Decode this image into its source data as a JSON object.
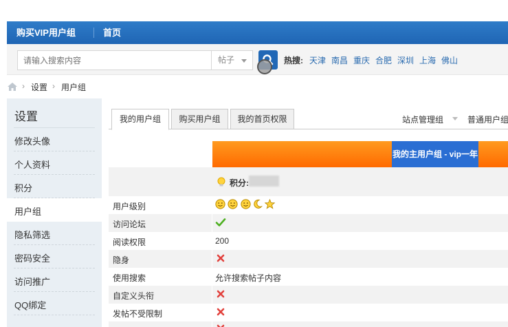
{
  "topbar": {
    "nav": [
      {
        "label": "购买VIP用户组"
      },
      {
        "label": "首页"
      }
    ]
  },
  "search": {
    "placeholder": "请输入搜索内容",
    "type_value": "帖子",
    "hot_label": "热搜:",
    "hot_links": [
      "天津",
      "南昌",
      "重庆",
      "合肥",
      "深圳",
      "上海",
      "佛山"
    ]
  },
  "breadcrumb": {
    "items": [
      "设置",
      "用户组"
    ]
  },
  "sidebar": {
    "title": "设置",
    "items": [
      {
        "label": "修改头像"
      },
      {
        "label": "个人资料"
      },
      {
        "label": "积分"
      },
      {
        "label": "用户组"
      },
      {
        "label": "隐私筛选"
      },
      {
        "label": "密码安全"
      },
      {
        "label": "访问推广"
      },
      {
        "label": "QQ绑定"
      }
    ],
    "active_index": 3
  },
  "tabs": {
    "items": [
      "我的用户组",
      "购买用户组",
      "我的首页权限"
    ],
    "right_items": [
      "站点管理组",
      "普通用户组"
    ]
  },
  "group": {
    "header": "我的主用户组 - vip一年",
    "points_label": "积分:",
    "header_colors": {
      "orange": "#ff7a00",
      "blue": "#2a6ed3"
    }
  },
  "permissions": [
    {
      "key": "用户级别",
      "value_type": "icons",
      "icons": [
        "smiley-icon",
        "smiley-icon",
        "smiley-icon",
        "moon-icon",
        "star-icon"
      ]
    },
    {
      "key": "访问论坛",
      "value_type": "yes"
    },
    {
      "key": "阅读权限",
      "value_type": "text",
      "value": "200"
    },
    {
      "key": "隐身",
      "value_type": "no"
    },
    {
      "key": "使用搜索",
      "value_type": "text",
      "value": "允许搜索帖子内容"
    },
    {
      "key": "自定义头衔",
      "value_type": "no"
    },
    {
      "key": "发帖不受限制",
      "value_type": "no"
    },
    {
      "key": "",
      "value_type": "no"
    }
  ]
}
